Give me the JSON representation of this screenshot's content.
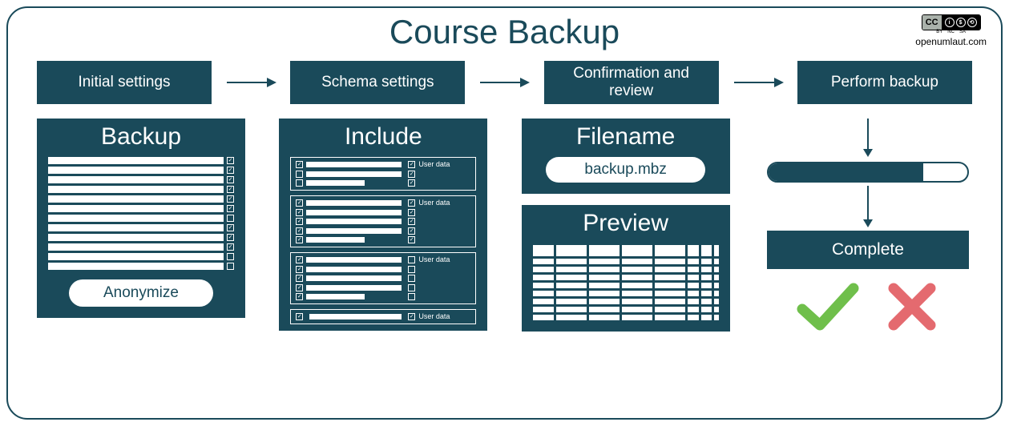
{
  "title": "Course Backup",
  "attribution": {
    "site": "openumlaut.com",
    "license_letters": [
      "i",
      "$",
      "⟲"
    ],
    "license_sub": [
      "BY",
      "NC",
      "SA"
    ]
  },
  "steps": {
    "s1": "Initial settings",
    "s2": "Schema settings",
    "s3": "Confirmation and review",
    "s4": "Perform backup"
  },
  "backup": {
    "heading": "Backup",
    "rows": [
      {
        "checked": true
      },
      {
        "checked": true
      },
      {
        "checked": true
      },
      {
        "checked": true
      },
      {
        "checked": true
      },
      {
        "checked": true
      },
      {
        "checked": false
      },
      {
        "checked": true
      },
      {
        "checked": true
      },
      {
        "checked": true
      },
      {
        "checked": false
      },
      {
        "checked": false
      }
    ],
    "anonymize": "Anonymize"
  },
  "include": {
    "heading": "Include",
    "user_data_label": "User data",
    "sections": [
      {
        "left": [
          {
            "c": true
          },
          {
            "c": false
          },
          {
            "c": false,
            "short": true
          }
        ],
        "right": [
          {
            "c": true,
            "label": true
          },
          {
            "c": true
          },
          {
            "c": true
          }
        ]
      },
      {
        "left": [
          {
            "c": true
          },
          {
            "c": true
          },
          {
            "c": true
          },
          {
            "c": true
          },
          {
            "c": true,
            "short": true
          }
        ],
        "right": [
          {
            "c": true,
            "label": true
          },
          {
            "c": true
          },
          {
            "c": true
          },
          {
            "c": true
          },
          {
            "c": true
          }
        ]
      },
      {
        "left": [
          {
            "c": true
          },
          {
            "c": true
          },
          {
            "c": true
          },
          {
            "c": true
          },
          {
            "c": true,
            "short": true
          }
        ],
        "right": [
          {
            "c": false,
            "label": true
          },
          {
            "c": false
          },
          {
            "c": false
          },
          {
            "c": false
          },
          {
            "c": false
          }
        ]
      }
    ],
    "single": {
      "left_checked": true,
      "right_checked": true
    }
  },
  "filename": {
    "heading": "Filename",
    "value": "backup.mbz"
  },
  "preview": {
    "heading": "Preview",
    "cols": [
      28,
      40,
      40,
      40,
      40,
      14,
      14,
      6
    ],
    "rows": 9
  },
  "perform": {
    "progress_pct": 78,
    "complete": "Complete"
  }
}
